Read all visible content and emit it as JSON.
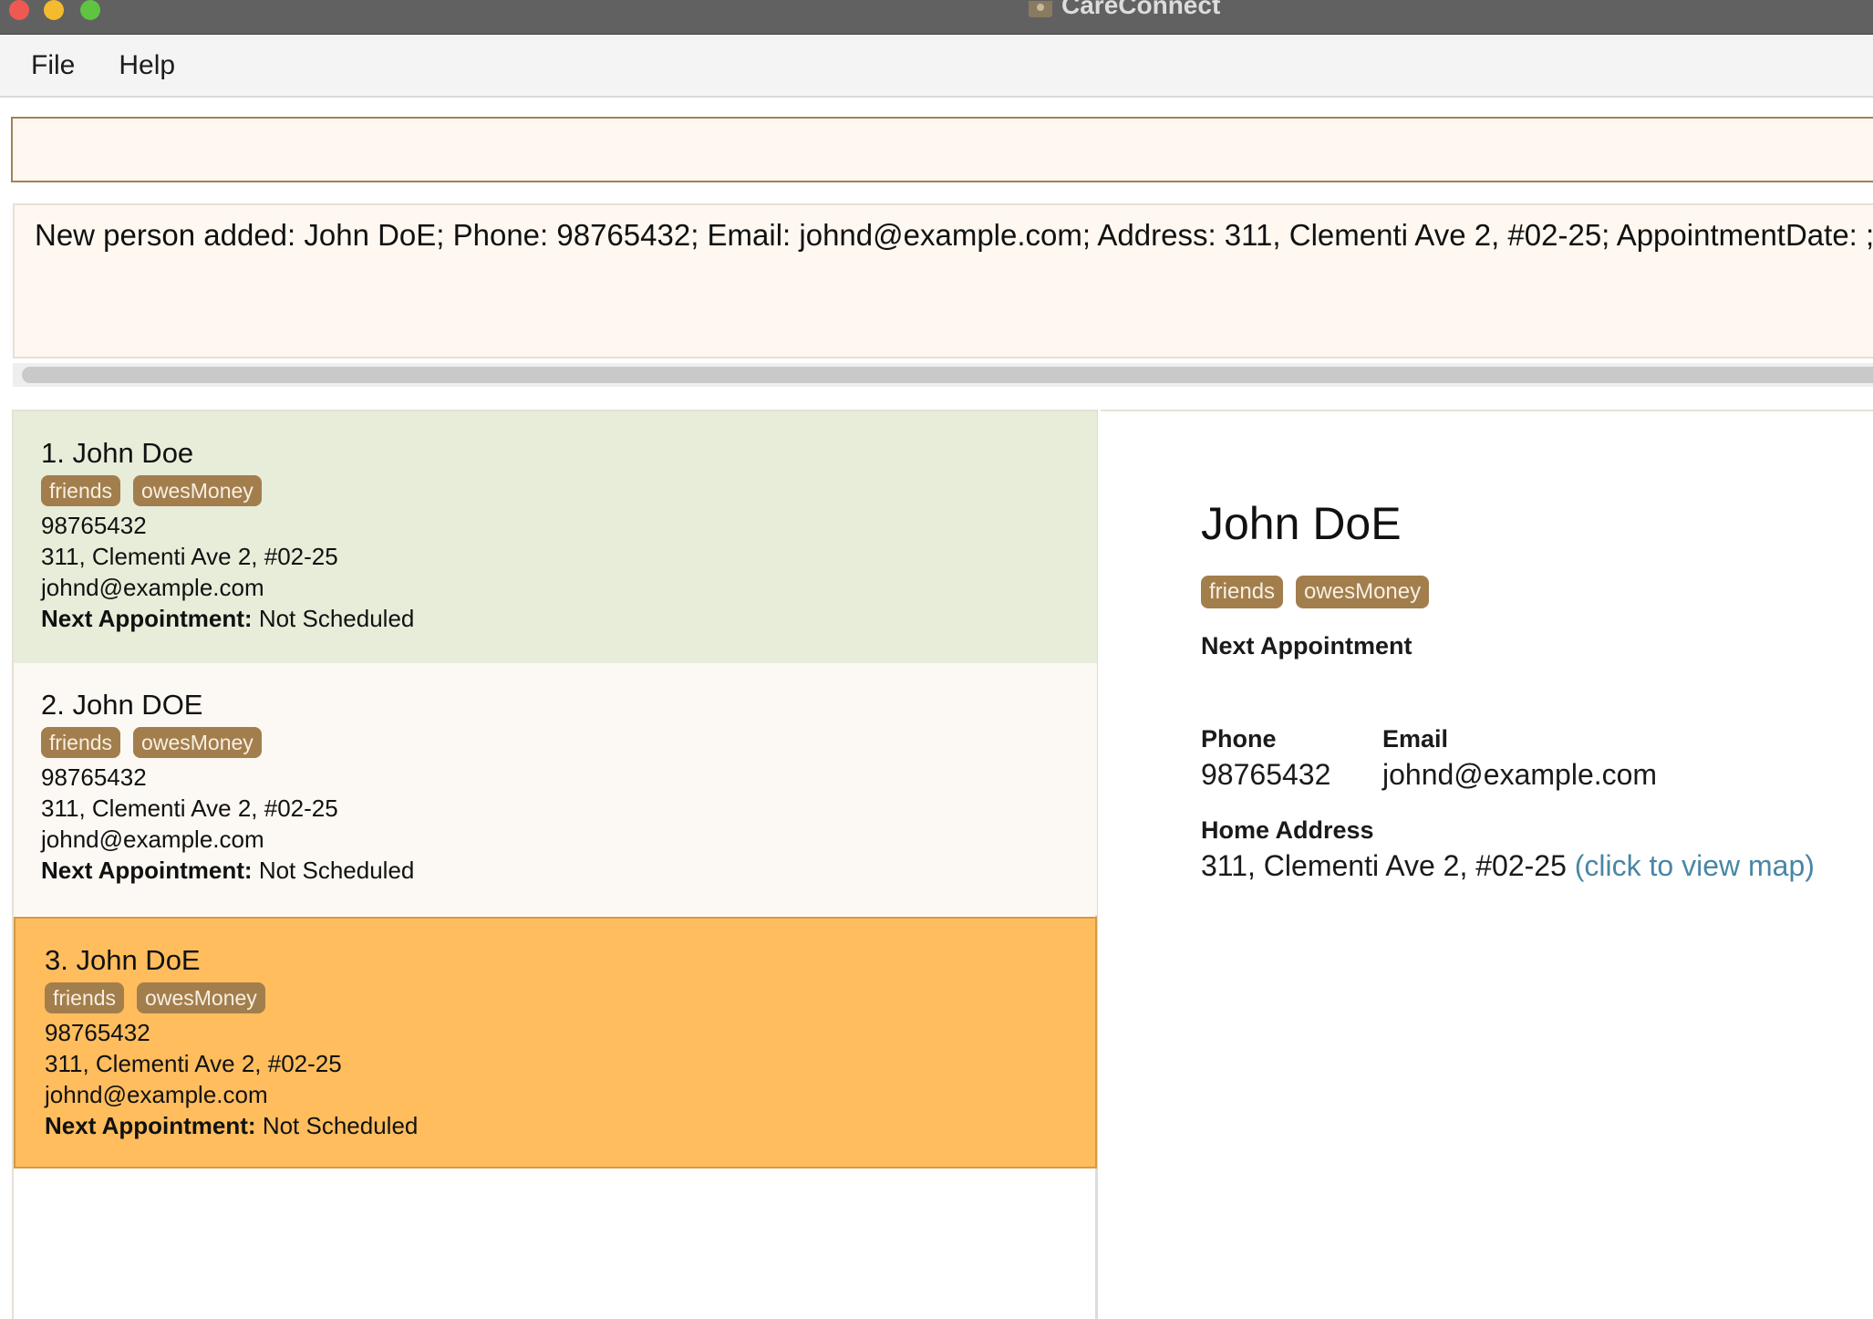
{
  "window": {
    "title": "CareConnect"
  },
  "menu": {
    "file": "File",
    "help": "Help"
  },
  "command": {
    "value": "",
    "placeholder": ""
  },
  "result": {
    "message": "New person added: John DoE; Phone: 98765432; Email: johnd@example.com; Address: 311, Clementi Ave 2, #02-25; AppointmentDate: ; T"
  },
  "persons": [
    {
      "name": "1. John Doe",
      "tags": [
        "friends",
        "owesMoney"
      ],
      "phone": "98765432",
      "address": "311, Clementi Ave 2, #02-25",
      "email": "johnd@example.com",
      "appointment_label": "Next Appointment:",
      "appointment_value": "Not Scheduled"
    },
    {
      "name": "2. John DOE",
      "tags": [
        "friends",
        "owesMoney"
      ],
      "phone": "98765432",
      "address": "311, Clementi Ave 2, #02-25",
      "email": "johnd@example.com",
      "appointment_label": "Next Appointment:",
      "appointment_value": "Not Scheduled"
    },
    {
      "name": "3. John DoE",
      "tags": [
        "friends",
        "owesMoney"
      ],
      "phone": "98765432",
      "address": "311, Clementi Ave 2, #02-25",
      "email": "johnd@example.com",
      "appointment_label": "Next Appointment:",
      "appointment_value": "Not Scheduled"
    }
  ],
  "detail": {
    "name": "John DoE",
    "tags": [
      "friends",
      "owesMoney"
    ],
    "next_appointment_label": "Next Appointment",
    "phone_label": "Phone",
    "phone": "98765432",
    "email_label": "Email",
    "email": "johnd@example.com",
    "address_label": "Home Address",
    "address": "311, Clementi Ave 2, #02-25",
    "map_link": "(click to view map)"
  },
  "colors": {
    "selected_card": "#ffbd5e",
    "first_card": "#e8edda",
    "tag_bg": "#a37e4d",
    "link": "#4a86a6"
  }
}
